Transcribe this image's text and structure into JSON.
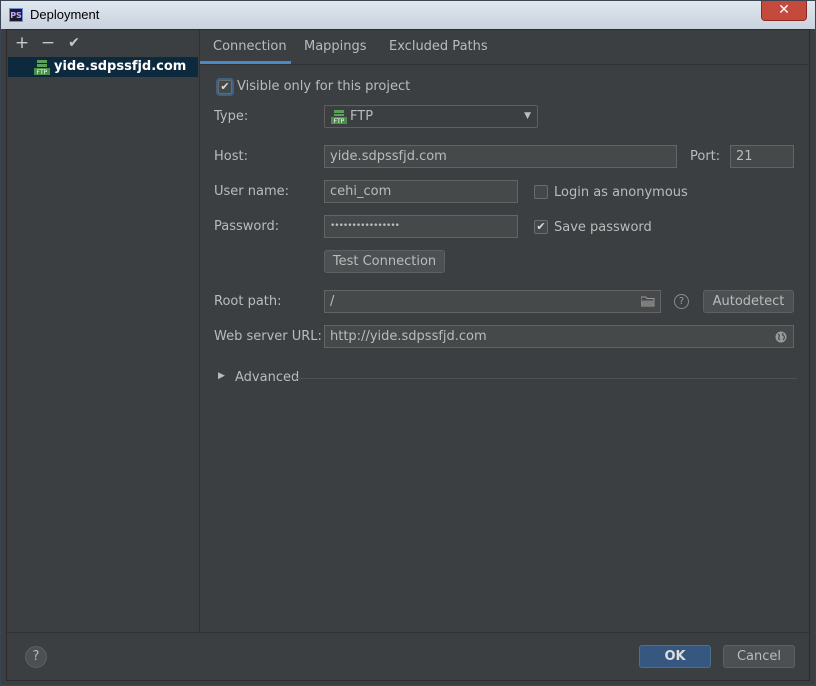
{
  "window": {
    "title": "Deployment",
    "app_icon": "PS",
    "close_icon": "✕"
  },
  "toolbar": {
    "add": "+",
    "remove": "−",
    "apply": "✔"
  },
  "servers": [
    {
      "label": "yide.sdpssfjd.com",
      "icon": "ftp-server-icon"
    }
  ],
  "tabs": [
    {
      "label": "Connection",
      "active": true
    },
    {
      "label": "Mappings"
    },
    {
      "label": "Excluded Paths"
    }
  ],
  "connection": {
    "visible_only": {
      "label": "Visible only for this project",
      "checked": true
    },
    "type": {
      "label": "Type:",
      "value": "FTP",
      "icon_text": "FTP"
    },
    "host": {
      "label": "Host:",
      "value": "yide.sdpssfjd.com"
    },
    "port": {
      "label": "Port:",
      "value": "21"
    },
    "username": {
      "label": "User name:",
      "value": "cehi_com"
    },
    "anonymous": {
      "label": "Login as anonymous",
      "checked": false
    },
    "password": {
      "label": "Password:",
      "value": "••••••••••••••••"
    },
    "save_password": {
      "label": "Save password",
      "checked": true
    },
    "test_button": "Test Connection",
    "root_path": {
      "label": "Root path:",
      "value": "/"
    },
    "autodetect_button": "Autodetect",
    "web_url": {
      "label": "Web server URL:",
      "value": "http://yide.sdpssfjd.com"
    },
    "advanced": "Advanced"
  },
  "footer": {
    "help": "?",
    "ok": "OK",
    "cancel": "Cancel"
  },
  "colors": {
    "accent": "#4a88c7",
    "selection": "#0d293e",
    "primary_button": "#365880",
    "background": "#3c3f41"
  }
}
